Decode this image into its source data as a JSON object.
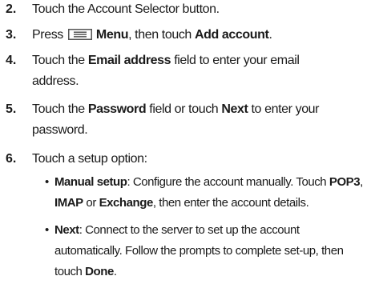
{
  "steps": [
    {
      "number": "2.",
      "text": "Touch the Account Selector button."
    },
    {
      "number": "3.",
      "prefix": "Press",
      "menu_label": "Menu",
      "middle": ", then touch",
      "add_account": "Add account",
      "suffix": "."
    },
    {
      "number": "4.",
      "prefix": "Touch the",
      "field": "Email address",
      "line1_rest": "field to enter your email",
      "line2": "address."
    },
    {
      "number": "5.",
      "prefix": "Touch the",
      "field": "Password",
      "middle": "field or touch",
      "next": "Next",
      "line1_rest": "to enter your",
      "line2": "password."
    },
    {
      "number": "6.",
      "text": "Touch a setup option:"
    }
  ],
  "options": [
    {
      "bullet": "•",
      "title": "Manual setup",
      "line1_text": ": Configure the account manually. Touch",
      "pop3": "POP3",
      "comma": ",",
      "imap": "IMAP",
      "or": "or",
      "exchange": "Exchange",
      "line2_rest": ", then enter the account details."
    },
    {
      "bullet": "•",
      "title": "Next",
      "line1_text": ": Connect to the server to set up the account",
      "line2": "automatically. Follow the prompts to complete set-up, then",
      "line3_prefix": "touch",
      "done": "Done",
      "period": "."
    }
  ],
  "icons": {
    "menu_icon": "menu-icon"
  },
  "colors": {
    "text": "#1a1a1a",
    "icon": "#555555"
  }
}
